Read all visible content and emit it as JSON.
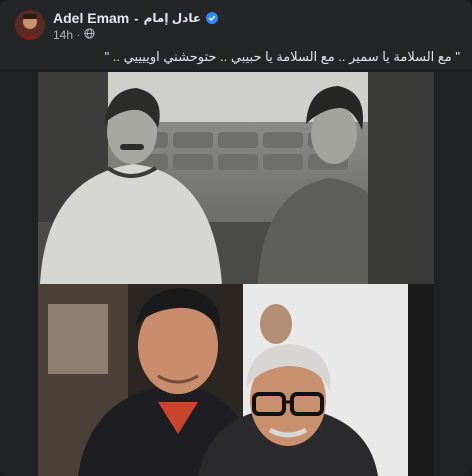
{
  "post": {
    "author_name": "Adel Emam",
    "author_separator": "-",
    "author_arabic_name": "عادل إمام",
    "verified_icon": "verified-badge-icon",
    "time": "14h",
    "time_separator": "·",
    "audience_icon": "globe-icon",
    "caption": "\" مع السلامة يا سمير .. مع السلامة يا حبيبي  .. حتوحشني اوييييي .. \""
  },
  "media": {
    "top_photo": "black-and-white-film-still-two-men",
    "bottom_photo": "color-photo-two-men-embracing"
  },
  "colors": {
    "card_bg": "#242526",
    "text_primary": "#e4e6eb",
    "text_secondary": "#b0b3b8",
    "verified_blue": "#2d88ff"
  }
}
